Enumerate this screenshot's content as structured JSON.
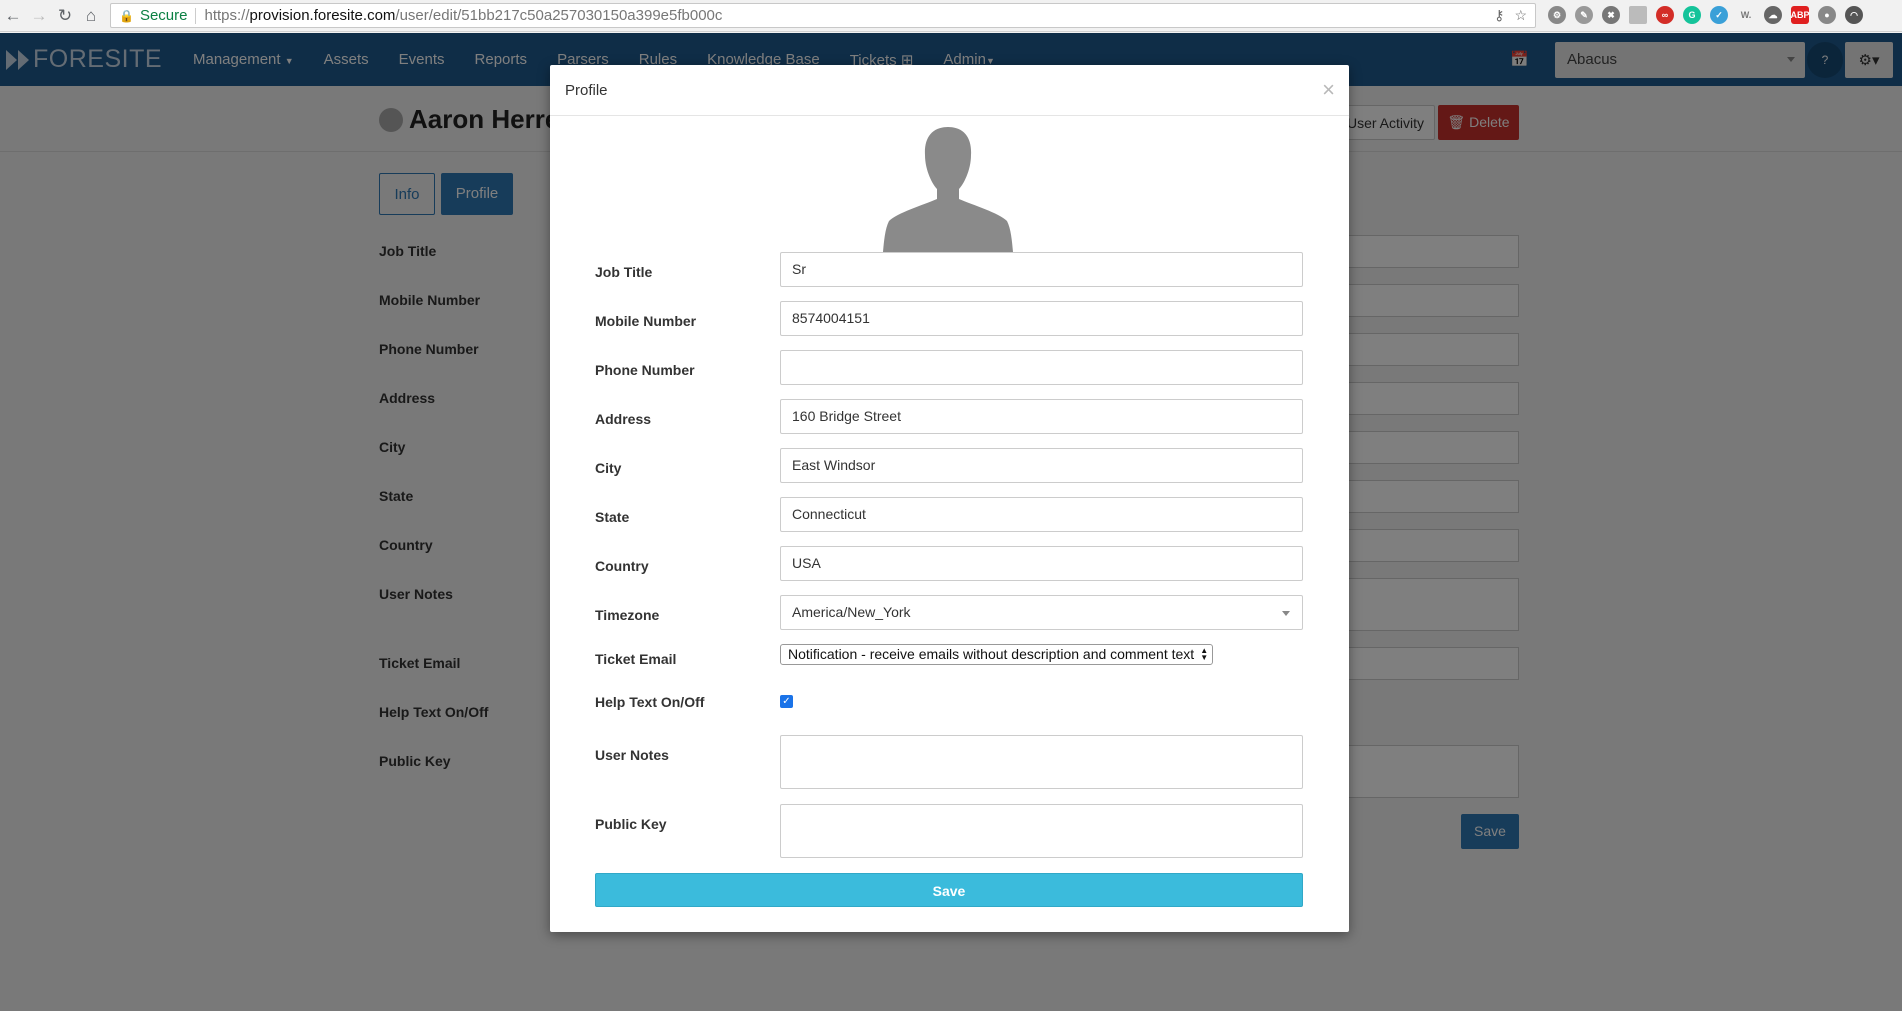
{
  "browser": {
    "secure_label": "Secure",
    "url_scheme": "https://",
    "url_host": "provision.foresite.com",
    "url_path": "/user/edit/51bb217c50a257030150a399e5fb000c"
  },
  "navbar": {
    "brand": "FORESITE",
    "menu": [
      {
        "label": "Management",
        "caret": true
      },
      {
        "label": "Assets"
      },
      {
        "label": "Events"
      },
      {
        "label": "Reports"
      },
      {
        "label": "Parsers"
      },
      {
        "label": "Rules"
      },
      {
        "label": "Knowledge Base"
      },
      {
        "label": "Tickets"
      },
      {
        "label": "Admin",
        "caret": true
      }
    ],
    "org_select": "Abacus",
    "brand_color": "#1e5a8e"
  },
  "page": {
    "user_name": "Aaron Herrel",
    "activity_button": "User Activity",
    "delete_button": "Delete",
    "tabs": [
      "Info",
      "Profile"
    ],
    "labels": [
      "Job Title",
      "Mobile Number",
      "Phone Number",
      "Address",
      "City",
      "State",
      "Country",
      "User Notes",
      "Ticket Email",
      "Help Text On/Off",
      "Public Key"
    ],
    "save_button": "Save"
  },
  "modal": {
    "title": "Profile",
    "close_label": "×",
    "fields": {
      "job_title": {
        "label": "Job Title",
        "value": "Sr"
      },
      "mobile_number": {
        "label": "Mobile Number",
        "value": "8574004151"
      },
      "phone_number": {
        "label": "Phone Number",
        "value": ""
      },
      "address": {
        "label": "Address",
        "value": "160 Bridge Street"
      },
      "city": {
        "label": "City",
        "value": "East Windsor"
      },
      "state": {
        "label": "State",
        "value": "Connecticut"
      },
      "country": {
        "label": "Country",
        "value": "USA"
      },
      "timezone": {
        "label": "Timezone",
        "value": "America/New_York"
      },
      "ticket_email": {
        "label": "Ticket Email",
        "value": "Notification - receive emails without description and comment text"
      },
      "help_text": {
        "label": "Help Text On/Off",
        "checked": true
      },
      "user_notes": {
        "label": "User Notes",
        "value": ""
      },
      "public_key": {
        "label": "Public Key",
        "value": ""
      }
    },
    "save_button": "Save",
    "save_color": "#3bbbdc"
  }
}
